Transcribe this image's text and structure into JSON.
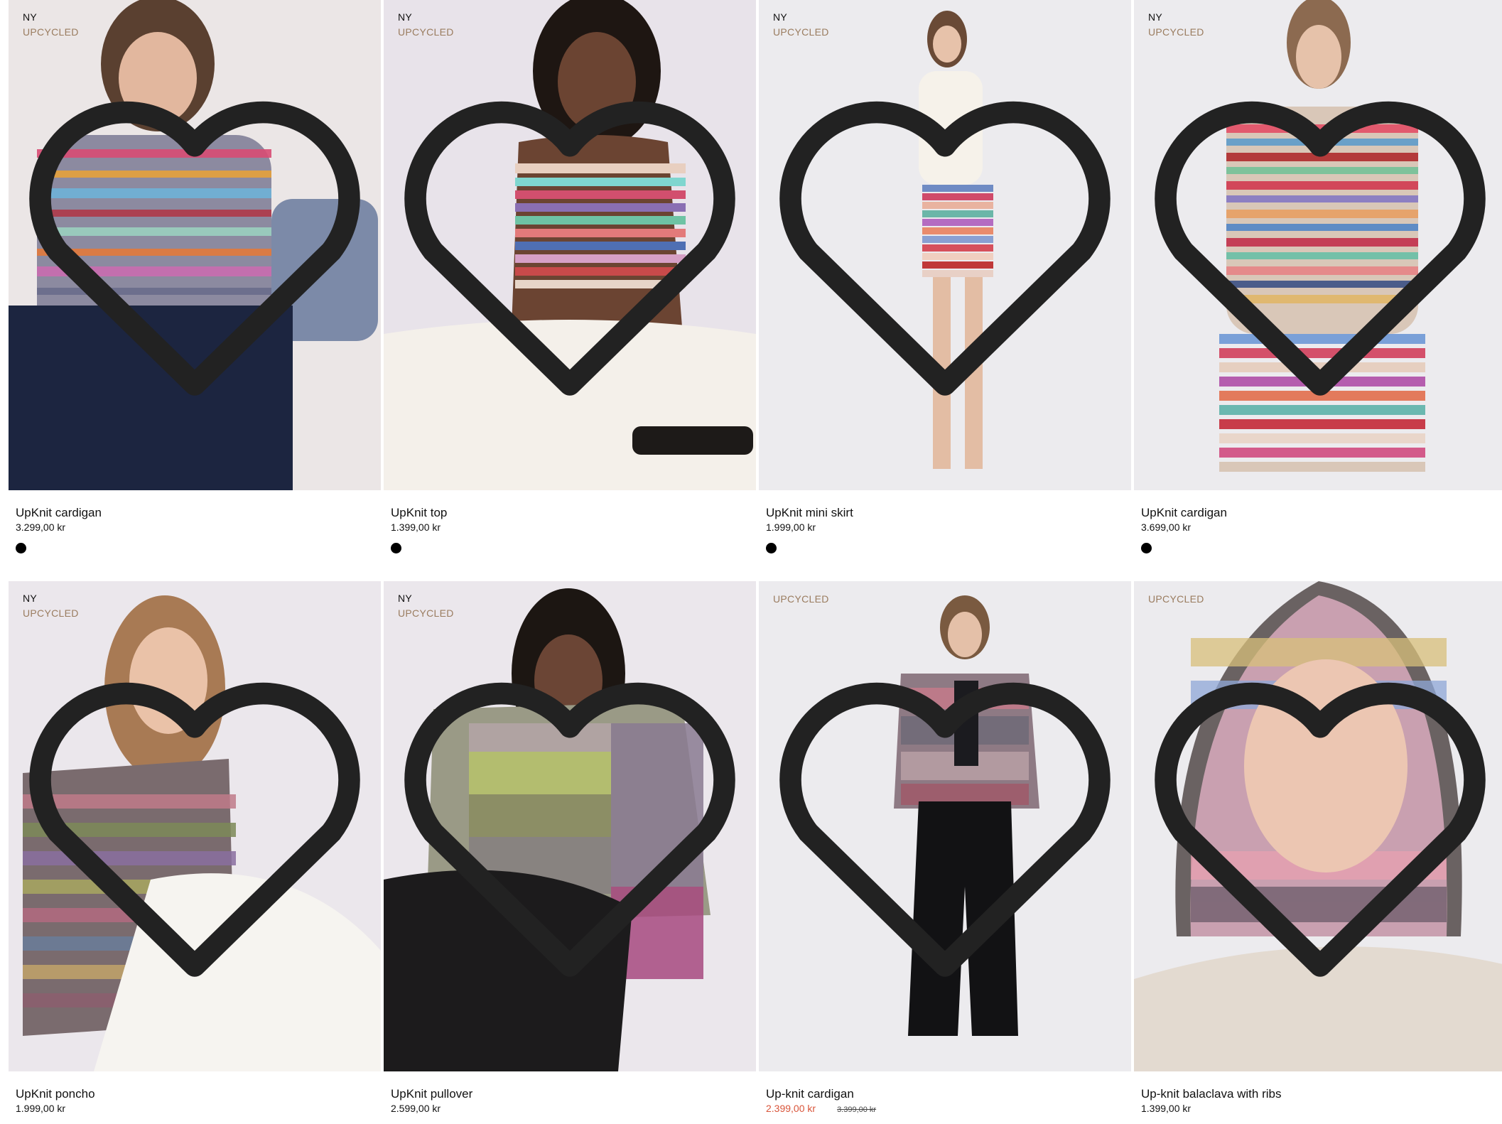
{
  "products": [
    {
      "badge_new": "NY",
      "badge_tag": "UPCYCLED",
      "name": "UpKnit cardigan",
      "price": "3.299,00 kr",
      "swatch_color": "#000000"
    },
    {
      "badge_new": "NY",
      "badge_tag": "UPCYCLED",
      "name": "UpKnit top",
      "price": "1.399,00 kr",
      "swatch_color": "#000000"
    },
    {
      "badge_new": "NY",
      "badge_tag": "UPCYCLED",
      "name": "UpKnit mini skirt",
      "price": "1.999,00 kr",
      "swatch_color": "#000000"
    },
    {
      "badge_new": "NY",
      "badge_tag": "UPCYCLED",
      "name": "UpKnit cardigan",
      "price": "3.699,00 kr",
      "swatch_color": "#000000"
    },
    {
      "badge_new": "NY",
      "badge_tag": "UPCYCLED",
      "name": "UpKnit poncho",
      "price": "1.999,00 kr"
    },
    {
      "badge_new": "NY",
      "badge_tag": "UPCYCLED",
      "name": "UpKnit pullover",
      "price": "2.599,00 kr"
    },
    {
      "badge_tag": "UPCYCLED",
      "name": "Up-knit cardigan",
      "price": "2.399,00 kr",
      "price_old": "3.399,00 kr"
    },
    {
      "badge_tag": "UPCYCLED",
      "name": "Up-knit balaclava with ribs",
      "price": "1.399,00 kr"
    }
  ],
  "icons": {
    "wishlist": "heart-outline-icon",
    "swatch": "color-swatch"
  },
  "colors": {
    "tag": "#9a7c5f",
    "sale": "#d9553a",
    "photo_bg": "#ece8ec"
  }
}
